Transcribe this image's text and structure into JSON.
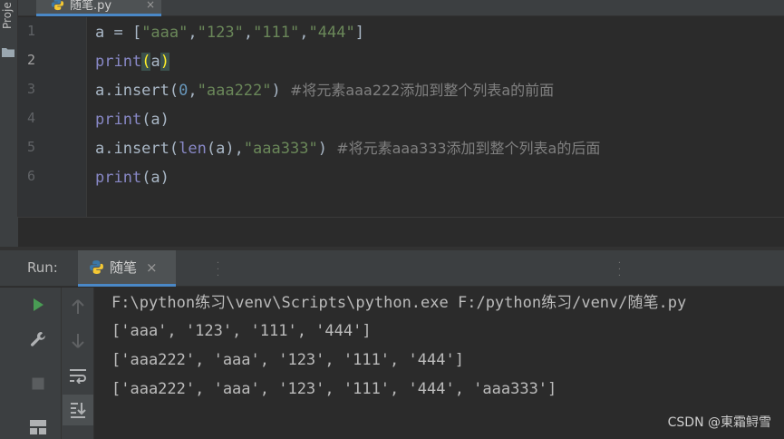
{
  "sidebar": {
    "project_label": "Proje",
    "folder_icon": "folder-icon"
  },
  "editor": {
    "tab": {
      "file_name": "随笔.py",
      "icon": "python-icon",
      "close": "×"
    },
    "current_line": 2,
    "line_numbers": [
      "1",
      "2",
      "3",
      "4",
      "5",
      "6"
    ],
    "lines": [
      [
        {
          "t": "a = [",
          "c": "plain"
        },
        {
          "t": "\"aaa\"",
          "c": "str"
        },
        {
          "t": ",",
          "c": "plain"
        },
        {
          "t": "\"123\"",
          "c": "str"
        },
        {
          "t": ",",
          "c": "plain"
        },
        {
          "t": "\"111\"",
          "c": "str"
        },
        {
          "t": ",",
          "c": "plain"
        },
        {
          "t": "\"444\"",
          "c": "str"
        },
        {
          "t": "]",
          "c": "plain"
        }
      ],
      [
        {
          "t": "print",
          "c": "kw-fn"
        },
        {
          "t": "(",
          "c": "brace-hl"
        },
        {
          "t": "a",
          "c": "plain"
        },
        {
          "t": ")",
          "c": "brace-hl"
        }
      ],
      [
        {
          "t": "a.insert(",
          "c": "plain"
        },
        {
          "t": "0",
          "c": "num"
        },
        {
          "t": ",",
          "c": "plain"
        },
        {
          "t": "\"aaa222\"",
          "c": "str"
        },
        {
          "t": ") ",
          "c": "plain"
        },
        {
          "t": "#将元素aaa222添加到整个列表a的前面",
          "c": "cmt"
        }
      ],
      [
        {
          "t": "print",
          "c": "kw-fn"
        },
        {
          "t": "(a)",
          "c": "plain"
        }
      ],
      [
        {
          "t": "a.insert(",
          "c": "plain"
        },
        {
          "t": "len",
          "c": "kw-fn"
        },
        {
          "t": "(a)",
          "c": "plain"
        },
        {
          "t": ",",
          "c": "plain"
        },
        {
          "t": "\"aaa333\"",
          "c": "str"
        },
        {
          "t": ") ",
          "c": "plain"
        },
        {
          "t": "#将元素aaa333添加到整个列表a的后面",
          "c": "cmt"
        }
      ],
      [
        {
          "t": "print",
          "c": "kw-fn"
        },
        {
          "t": "(a)",
          "c": "plain"
        }
      ]
    ]
  },
  "run_panel": {
    "title": "Run:",
    "tab": {
      "name": "随笔",
      "icon": "python-icon",
      "close": "×"
    },
    "toolbar_left": [
      "run-icon",
      "wrench-icon",
      "stop-icon",
      "layout-icon"
    ],
    "toolbar_right": [
      "arrow-up-icon",
      "arrow-down-icon",
      "soft-wrap-icon",
      "scroll-to-end-icon"
    ],
    "output": [
      "F:\\python练习\\venv\\Scripts\\python.exe F:/python练习/venv/随笔.py",
      "['aaa', '123', '111', '444']",
      "['aaa222', 'aaa', '123', '111', '444']",
      "['aaa222', 'aaa', '123', '111', '444', 'aaa333']"
    ]
  },
  "watermark": "CSDN @東霜鲟雪",
  "colors": {
    "background": "#2b2b2b",
    "string": "#6a8759",
    "builtin": "#8888c6",
    "number": "#6897bb",
    "comment": "#808080",
    "run_green": "#499c54",
    "accent": "#4a88c7"
  }
}
